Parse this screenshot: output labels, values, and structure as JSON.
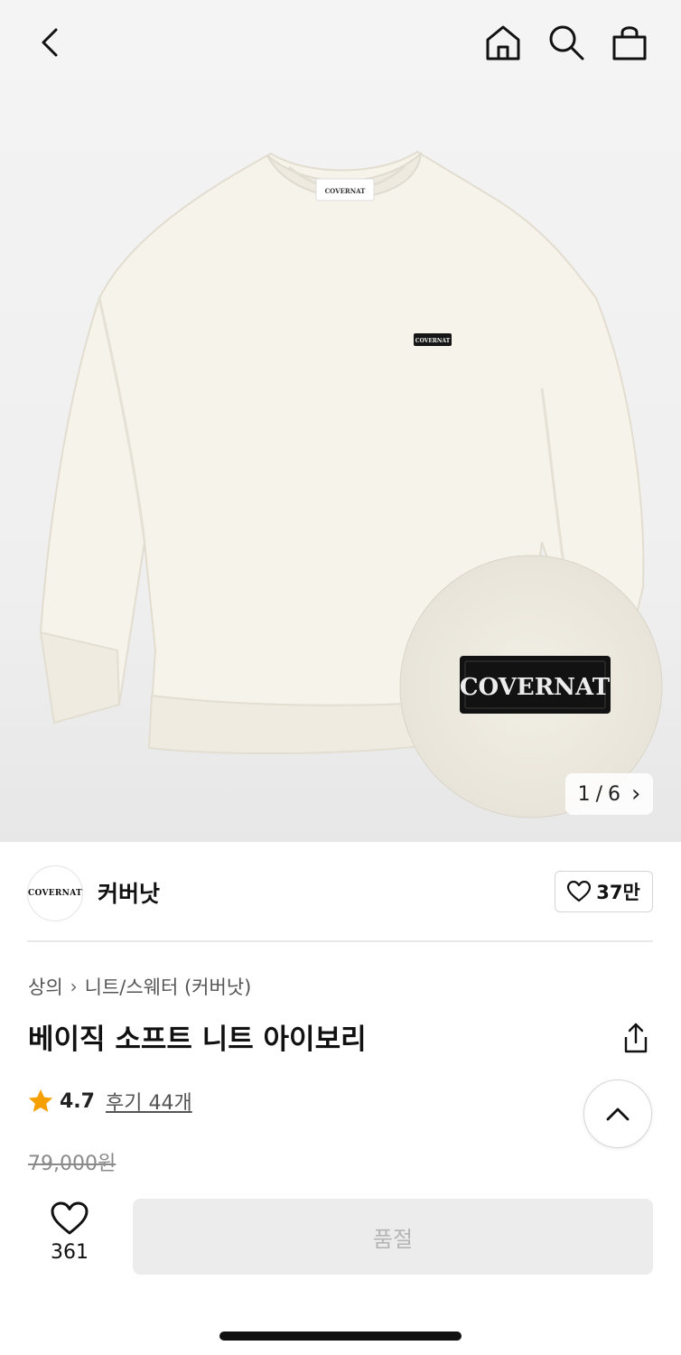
{
  "header": {
    "icons": [
      "back-icon",
      "home-icon",
      "search-icon",
      "shopping-bag-icon"
    ]
  },
  "hero": {
    "garment_label_text": "COVERNAT",
    "zoom_label_text": "COVERNAT",
    "counter_current": "1",
    "counter_separator": "/",
    "counter_total": "6",
    "counter_arrow": "›"
  },
  "brand": {
    "logo_text": "COVERNAT",
    "name": "커버낫",
    "likes": "37만"
  },
  "breadcrumb": {
    "category": "상의",
    "separator": "›",
    "subcategory": "니트/스웨터 (커버낫)"
  },
  "product": {
    "title": "베이직 소프트 니트 아이보리",
    "rating": "4.7",
    "review_link": "후기 44개",
    "original_price": "79,000원"
  },
  "bottom_bar": {
    "wish_count": "361",
    "action_label": "품절"
  },
  "colors": {
    "star": "#f5a000",
    "soldout_bg": "#ececec",
    "soldout_text": "#b5b5b5"
  }
}
